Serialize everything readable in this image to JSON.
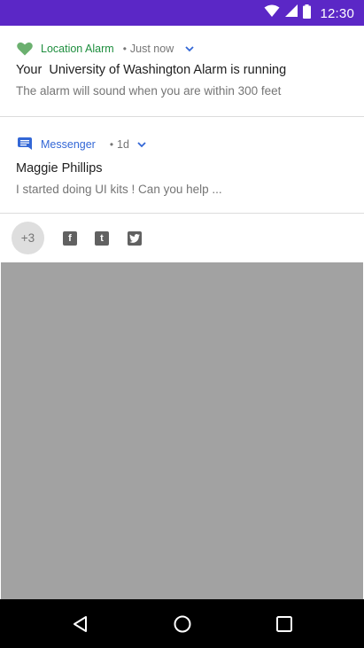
{
  "status_bar": {
    "time": "12:30",
    "background": "#5b27c6",
    "icons": [
      "wifi-icon",
      "cell-signal-icon",
      "battery-icon"
    ]
  },
  "notifications": [
    {
      "app_name": "Location Alarm",
      "app_color": "#1e8e3e",
      "icon": "heart-icon",
      "separator": "•",
      "time": "Just now",
      "title": "Your  University of Washington Alarm is running",
      "text": "The alarm will sound when you are within 300 feet"
    },
    {
      "app_name": "Messenger",
      "app_color": "#3367d6",
      "icon": "message-icon",
      "separator": "•",
      "time": "1d",
      "title": "Maggie Phillips",
      "text": "I started doing UI kits ! Can you help ..."
    }
  ],
  "overflow": {
    "badge": "+3",
    "icons": [
      "facebook-icon",
      "tumblr-icon",
      "twitter-icon"
    ],
    "glyphs": [
      "f",
      "t",
      "t"
    ]
  },
  "nav_bar": {
    "buttons": [
      "back-icon",
      "home-icon",
      "recents-icon"
    ]
  }
}
